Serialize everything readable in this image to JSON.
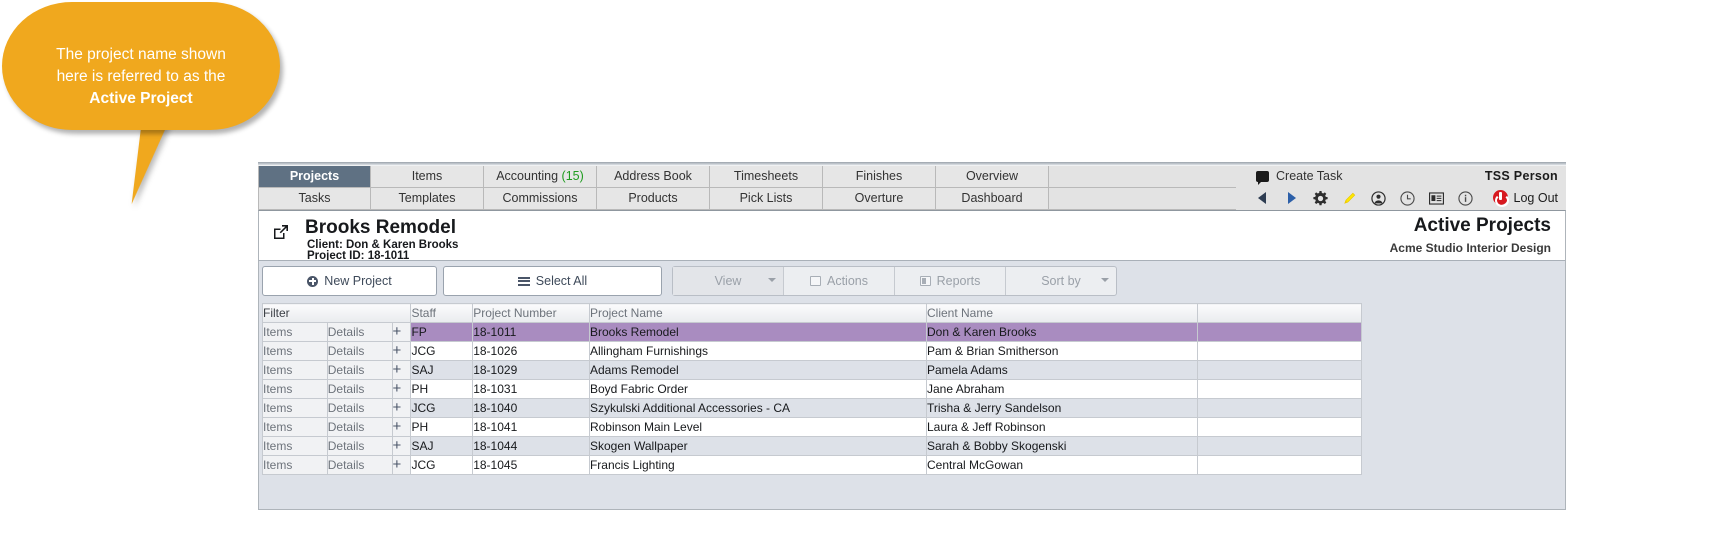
{
  "callout": {
    "line1": "The project name shown",
    "line2": "here is referred to as the",
    "line3": "Active Project",
    "color": "#f0a81e"
  },
  "tabs_row1": [
    {
      "label": "Projects",
      "active": true
    },
    {
      "label": "Items",
      "active": false
    },
    {
      "label": "Accounting",
      "count": "(15)",
      "active": false
    },
    {
      "label": "Address Book",
      "active": false
    },
    {
      "label": "Timesheets",
      "active": false
    },
    {
      "label": "Finishes",
      "active": false
    },
    {
      "label": "Overview",
      "active": false
    }
  ],
  "tabs_row2": [
    {
      "label": "Tasks",
      "active": false
    },
    {
      "label": "Templates",
      "active": false
    },
    {
      "label": "Commissions",
      "active": false
    },
    {
      "label": "Products",
      "active": false
    },
    {
      "label": "Pick Lists",
      "active": false
    },
    {
      "label": "Overture",
      "active": false
    },
    {
      "label": "Dashboard",
      "active": false
    }
  ],
  "user_bar": {
    "create_task": "Create Task",
    "user_name": "TSS Person",
    "log_out": "Log Out",
    "icons": [
      "prev-arrow-icon",
      "next-arrow-icon",
      "gear-icon",
      "pencil-icon",
      "user-circle-icon",
      "clock-icon",
      "id-card-icon",
      "info-icon"
    ]
  },
  "project_header": {
    "open_icon": "external-link-icon",
    "name": "Brooks Remodel",
    "client": "Client: Don & Karen Brooks",
    "project_id": "Project ID: 18-1011",
    "section_title": "Active Projects",
    "company": "Acme Studio Interior Design"
  },
  "toolbar": {
    "new_project": "New Project",
    "select_all": "Select All",
    "view": "View",
    "actions": "Actions",
    "reports": "Reports",
    "sort_by": "Sort by"
  },
  "table": {
    "headers": {
      "filter": "Filter",
      "staff": "Staff",
      "project_number": "Project Number",
      "project_name": "Project Name",
      "client_name": "Client Name",
      "blank": ""
    },
    "row_actions": {
      "items": "Items",
      "details": "Details",
      "add": "+"
    },
    "rows": [
      {
        "staff": "FP",
        "project_number": "18-1011",
        "project_name": "Brooks Remodel",
        "client_name": "Don & Karen Brooks",
        "state": "sel"
      },
      {
        "staff": "JCG",
        "project_number": "18-1026",
        "project_name": "Allingham Furnishings",
        "client_name": "Pam & Brian Smitherson",
        "state": "norm"
      },
      {
        "staff": "SAJ",
        "project_number": "18-1029",
        "project_name": "Adams Remodel",
        "client_name": "Pamela Adams",
        "state": "alt"
      },
      {
        "staff": "PH",
        "project_number": "18-1031",
        "project_name": "Boyd Fabric Order",
        "client_name": "Jane Abraham",
        "state": "norm"
      },
      {
        "staff": "JCG",
        "project_number": "18-1040",
        "project_name": "Szykulski Additional Accessories - CA",
        "client_name": "Trisha & Jerry Sandelson",
        "state": "alt"
      },
      {
        "staff": "PH",
        "project_number": "18-1041",
        "project_name": "Robinson Main Level",
        "client_name": "Laura & Jeff Robinson",
        "state": "norm"
      },
      {
        "staff": "SAJ",
        "project_number": "18-1044",
        "project_name": "Skogen Wallpaper",
        "client_name": "Sarah & Bobby Skogenski",
        "state": "alt"
      },
      {
        "staff": "JCG",
        "project_number": "18-1045",
        "project_name": "Francis Lighting",
        "client_name": "Central McGowan",
        "state": "norm"
      }
    ]
  }
}
